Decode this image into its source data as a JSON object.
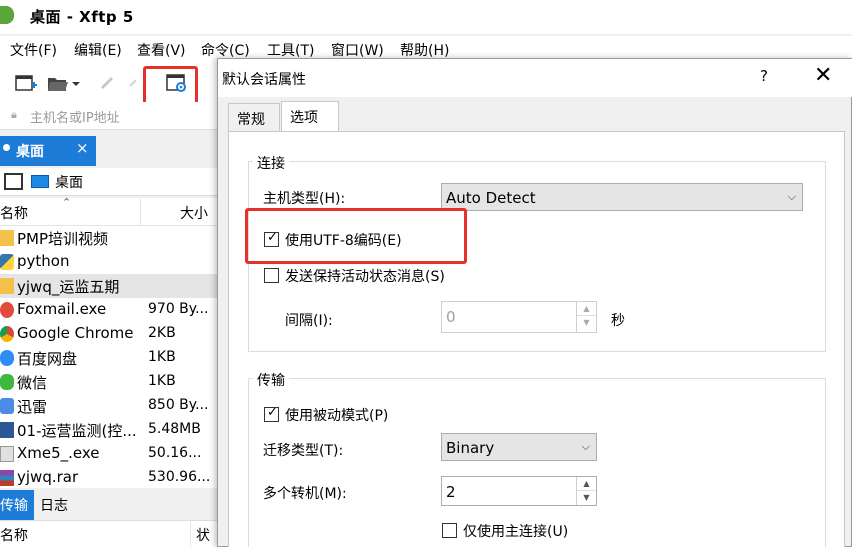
{
  "window": {
    "title": "桌面   - Xftp 5"
  },
  "menu": [
    "文件(F)",
    "编辑(E)",
    "查看(V)",
    "命令(C)",
    "工具(T)",
    "窗口(W)",
    "帮助(H)"
  ],
  "address": {
    "placeholder": "主机名或IP地址"
  },
  "left_tab": {
    "label": "桌面",
    "close": "×"
  },
  "path": {
    "label": "桌面"
  },
  "columns": {
    "name": "名称",
    "size": "大小"
  },
  "files": [
    {
      "name": "PMP培训视频",
      "size": "",
      "icon": "folder-icon"
    },
    {
      "name": "python",
      "size": "",
      "icon": "python-icon"
    },
    {
      "name": "yjwq_运监五期",
      "size": "",
      "icon": "folder-icon",
      "selected": true
    },
    {
      "name": "Foxmail.exe",
      "size": "970 By...",
      "icon": "foxmail-icon"
    },
    {
      "name": "Google Chrome",
      "size": "2KB",
      "icon": "chrome-icon"
    },
    {
      "name": "百度网盘",
      "size": "1KB",
      "icon": "cloud-icon"
    },
    {
      "name": "微信",
      "size": "1KB",
      "icon": "wechat-icon"
    },
    {
      "name": "迅雷",
      "size": "850 By...",
      "icon": "thunder-icon"
    },
    {
      "name": "01-运营监测(控...",
      "size": "5.48MB",
      "icon": "word-icon"
    },
    {
      "name": "Xme5_.exe",
      "size": "50.16...",
      "icon": "exe-icon"
    },
    {
      "name": "yjwq.rar",
      "size": "530.96...",
      "icon": "rar-icon"
    }
  ],
  "bottom_tabs": [
    "传输",
    "日志"
  ],
  "bottom_columns": {
    "name": "名称",
    "status": "状态"
  },
  "dialog": {
    "title": "默认会话属性",
    "help": "?",
    "close": "✕",
    "tabs": [
      "常规",
      "选项"
    ],
    "connection": {
      "group": "连接",
      "host_type_label": "主机类型(H):",
      "host_type_value": "Auto Detect",
      "utf8_label": "使用UTF-8编码(E)",
      "utf8_checked": true,
      "keepalive_label": "发送保持活动状态消息(S)",
      "keepalive_checked": false,
      "interval_label": "间隔(I):",
      "interval_value": "0",
      "interval_unit": "秒"
    },
    "transfer": {
      "group": "传输",
      "passive_label": "使用被动模式(P)",
      "passive_checked": true,
      "transfer_type_label": "迁移类型(T):",
      "transfer_type_value": "Binary",
      "multi_conn_label": "多个转机(M):",
      "multi_conn_value": "2",
      "main_conn_only_label": "仅使用主连接(U)",
      "main_conn_only_checked": false
    }
  }
}
